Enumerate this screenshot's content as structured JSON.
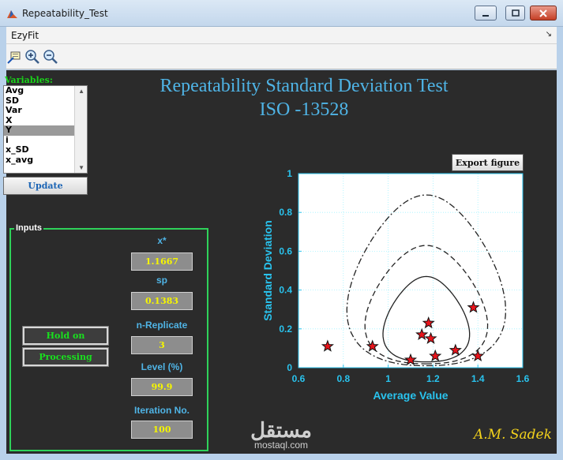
{
  "window": {
    "title": "Repeatability_Test"
  },
  "menu": {
    "items": [
      "EzyFit"
    ]
  },
  "toolbar": {
    "icons": [
      "data-cursor-icon",
      "zoom-in-icon",
      "zoom-out-icon"
    ]
  },
  "variables": {
    "label": "Variables:",
    "items": [
      "Avg",
      "SD",
      "Var",
      "X",
      "Y",
      "i",
      "x_SD",
      "x_avg"
    ],
    "selected": "Y"
  },
  "update_button": "Update",
  "title": {
    "line1": "Repeatability Standard Deviation Test",
    "line2": "ISO -13528"
  },
  "inputs": {
    "legend": "Inputs",
    "x_star": {
      "label": "x*",
      "value": "1.1667"
    },
    "sp": {
      "label": "sp",
      "value": "0.1383"
    },
    "n_replicate": {
      "label": "n-Replicate",
      "value": "3"
    },
    "level": {
      "label": "Level (%)",
      "value": "99.9"
    },
    "iteration": {
      "label": "Iteration No.",
      "value": "100"
    },
    "hold_button": "Hold on",
    "processing_button": "Processing"
  },
  "export_button": "Export figure",
  "colors": {
    "accent_blue": "#4fb4e6",
    "green": "#19e01e",
    "yellow": "#f5f500",
    "background": "#2b2b2b"
  },
  "chart_data": {
    "type": "scatter",
    "xlabel": "Average Value",
    "ylabel": "Standard Deviation",
    "xlim": [
      0.6,
      1.6
    ],
    "ylim": [
      0,
      1
    ],
    "xticks": [
      0.6,
      0.8,
      1,
      1.2,
      1.4,
      1.6
    ],
    "yticks": [
      0,
      0.2,
      0.4,
      0.6,
      0.8,
      1
    ],
    "grid": true,
    "points": {
      "x": [
        0.73,
        0.93,
        1.1,
        1.15,
        1.18,
        1.19,
        1.21,
        1.3,
        1.38,
        1.4
      ],
      "y": [
        0.11,
        0.11,
        0.04,
        0.17,
        0.23,
        0.15,
        0.06,
        0.09,
        0.31,
        0.06
      ]
    },
    "contours": [
      {
        "style": "solid",
        "x_center": 1.17,
        "x_half_width": 0.24,
        "y_min": 0.03,
        "y_max": 0.47
      },
      {
        "style": "dashed",
        "x_center": 1.17,
        "x_half_width": 0.34,
        "y_min": 0.02,
        "y_max": 0.63
      },
      {
        "style": "dash-dot",
        "x_center": 1.17,
        "x_half_width": 0.44,
        "y_min": 0.01,
        "y_max": 0.89
      }
    ]
  },
  "watermark": {
    "arabic": "مستقل",
    "latin": "mostaql.com"
  },
  "signature": "A.M. Sadek"
}
